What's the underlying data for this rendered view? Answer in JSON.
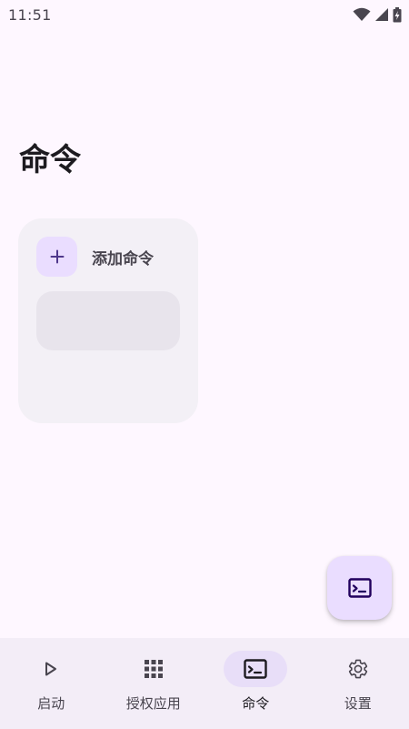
{
  "status_bar": {
    "time": "11:51",
    "icons": [
      "wifi-icon",
      "signal-icon",
      "battery-charging-icon"
    ]
  },
  "page": {
    "title": "命令"
  },
  "card": {
    "add_command_label": "添加命令",
    "add_icon": "plus-icon"
  },
  "fab": {
    "icon": "terminal-icon"
  },
  "bottom_nav": {
    "items": [
      {
        "label": "启动",
        "icon": "play-icon",
        "active": false
      },
      {
        "label": "授权应用",
        "icon": "apps-grid-icon",
        "active": false
      },
      {
        "label": "命令",
        "icon": "terminal-icon",
        "active": true
      },
      {
        "label": "设置",
        "icon": "gear-icon",
        "active": false
      }
    ]
  },
  "colors": {
    "background": "#fef7ff",
    "card": "#f3f0f6",
    "accent_container": "#eaddff",
    "nav_background": "#f3edf7",
    "nav_active_pill": "#e8def8",
    "text_primary": "#1d1b20",
    "text_secondary": "#49454f"
  }
}
